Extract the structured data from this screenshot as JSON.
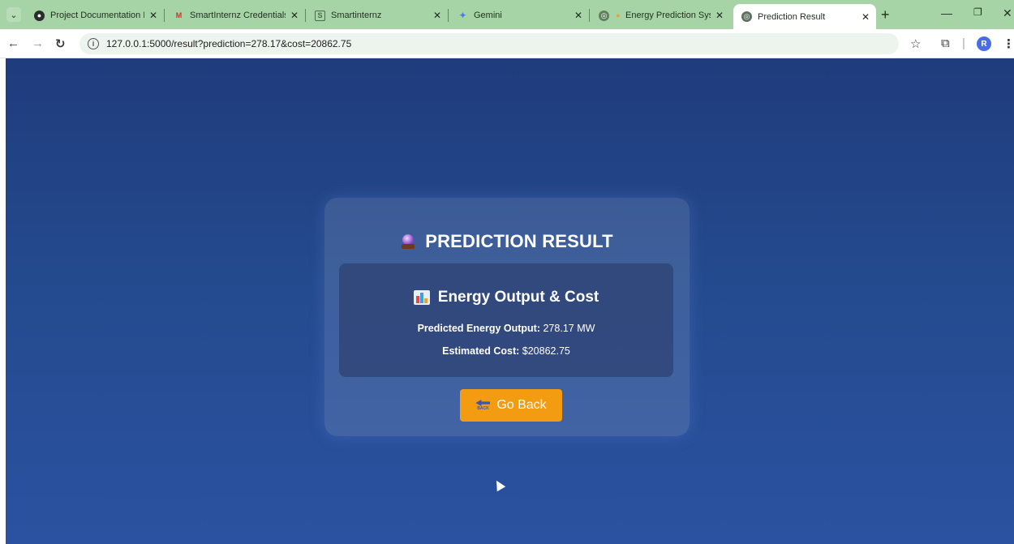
{
  "browser": {
    "tabs": [
      {
        "title": "Project Documentation Pro",
        "favicon": "circle-dark-icon"
      },
      {
        "title": "SmartInternz Credentials fo",
        "favicon": "gmail-icon"
      },
      {
        "title": "Smartinternz",
        "favicon": "smartinternz-icon"
      },
      {
        "title": "Gemini",
        "favicon": "gemini-star-icon"
      },
      {
        "title": "Energy Prediction Syste",
        "favicon": "globe-icon"
      },
      {
        "title": "Prediction Result",
        "favicon": "globe-icon"
      }
    ],
    "active_tab_index": 5,
    "new_tab_label": "+",
    "url": "127.0.0.1:5000/result?prediction=278.17&cost=20862.75",
    "avatar_letter": "R"
  },
  "page": {
    "title": "PREDICTION RESULT",
    "section_title": "Energy Output & Cost",
    "energy_label": "Predicted Energy Output:",
    "energy_value": "278.17 MW",
    "cost_label": "Estimated Cost:",
    "cost_value": "$20862.75",
    "back_button_label": "Go Back",
    "back_icon_text": "BACK"
  },
  "colors": {
    "tab_strip": "#a6d4a6",
    "page_bg_top": "#1f3c7c",
    "page_bg_bottom": "#2a52a0",
    "button": "#f39c12"
  }
}
